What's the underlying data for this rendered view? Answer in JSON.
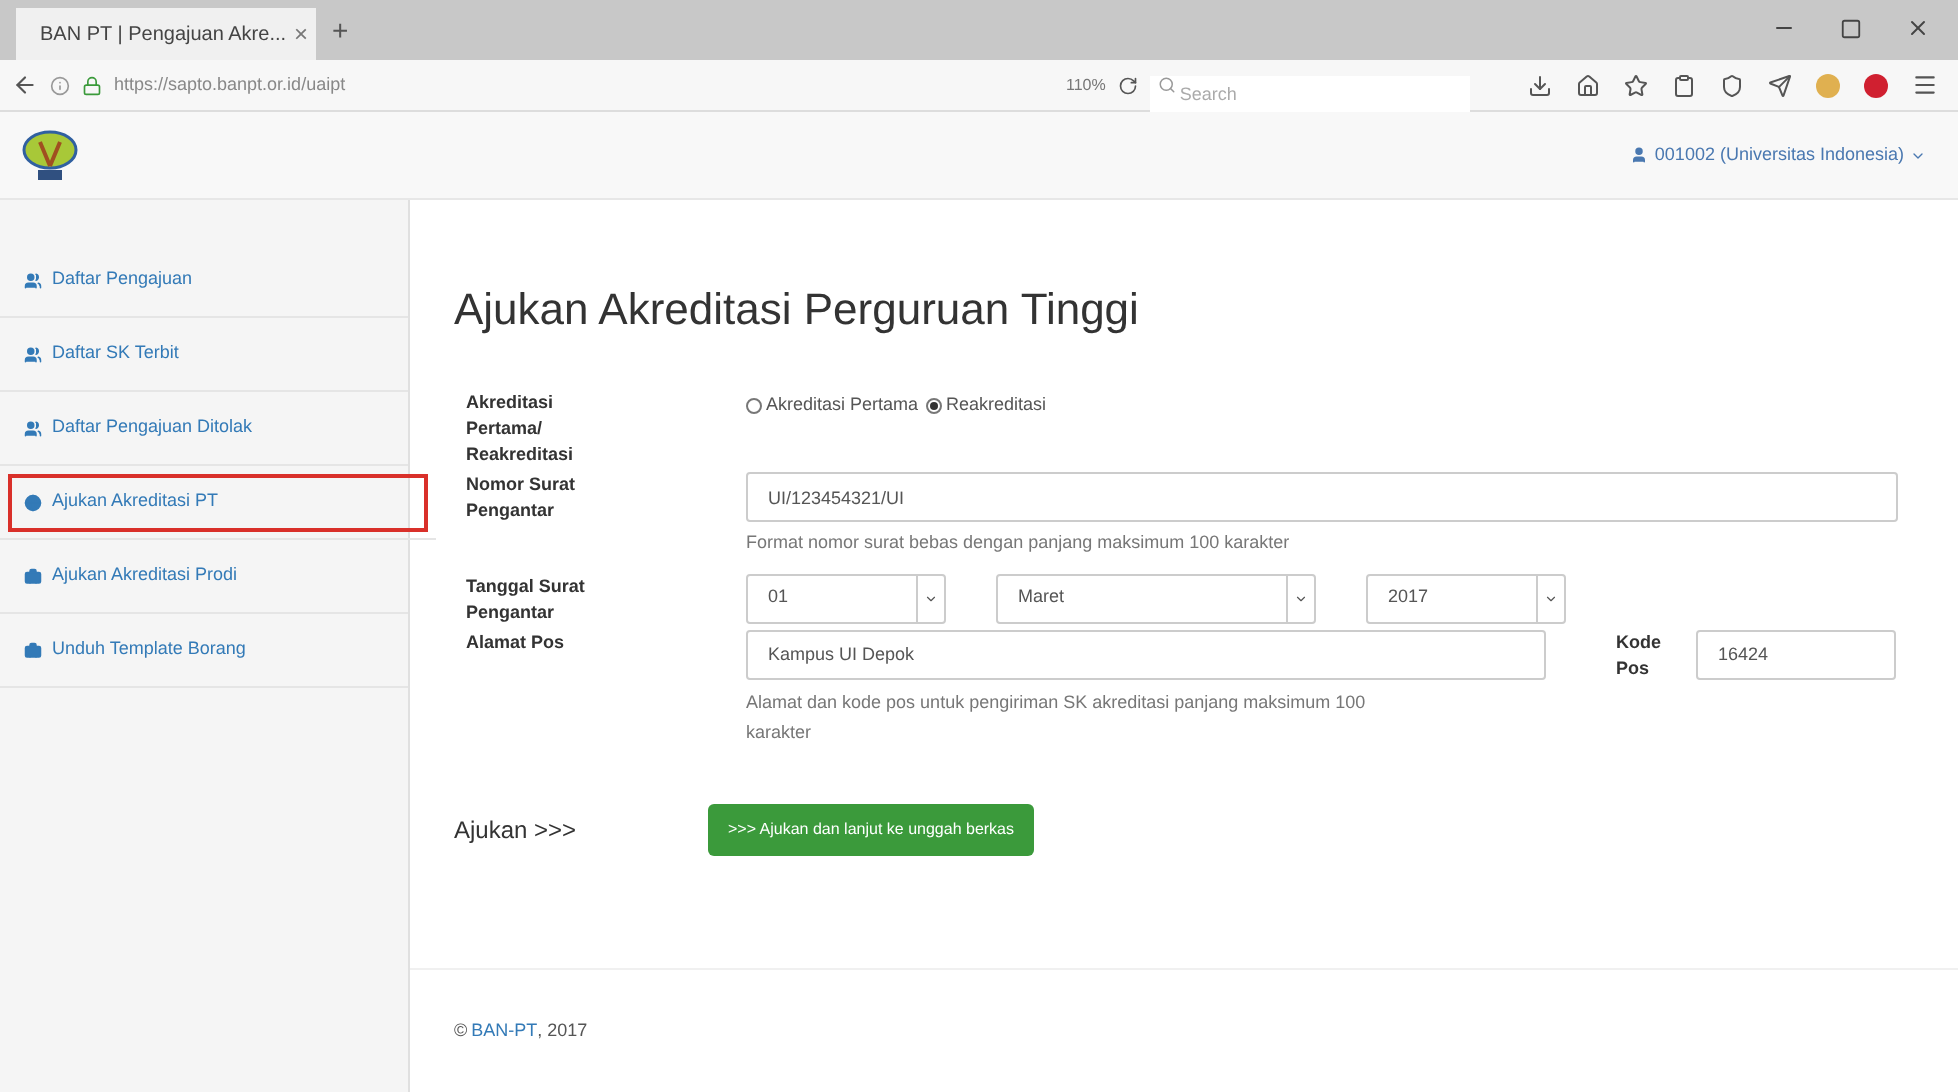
{
  "browser": {
    "tab_title": "BAN PT | Pengajuan Akre...",
    "tab_close": "×",
    "tab_new": "+",
    "url": "https://sapto.banpt.or.id/uaipt",
    "zoom": "110%",
    "search_placeholder": "Search"
  },
  "header": {
    "user": "001002 (Universitas Indonesia)"
  },
  "sidebar": {
    "items": [
      {
        "label": "Daftar Pengajuan",
        "annotated": false
      },
      {
        "label": "Daftar SK Terbit",
        "annotated": false
      },
      {
        "label": "Daftar Pengajuan Ditolak",
        "annotated": false
      },
      {
        "label": "Ajukan Akreditasi PT",
        "annotated": true
      },
      {
        "label": "Ajukan Akreditasi Prodi",
        "annotated": false
      },
      {
        "label": "Unduh Template Borang",
        "annotated": false
      }
    ]
  },
  "page_title": "Ajukan Akreditasi Perguruan Tinggi",
  "form": {
    "type_label": "Akreditasi Pertama/ Reakreditasi",
    "type_options": [
      {
        "label": "Akreditasi Pertama",
        "selected": false
      },
      {
        "label": "Reakreditasi",
        "selected": true
      }
    ],
    "number_label": "Nomor Surat Pengantar",
    "number_value": "UI/123454321/UI",
    "number_help": "Format nomor surat bebas dengan panjang maksimum 100 karakter",
    "date_label": "Tanggal Surat Pengantar",
    "date_selects": [
      {
        "value": "01"
      },
      {
        "value": "Maret"
      },
      {
        "value": "2017"
      }
    ],
    "address_label": "Alamat Pos",
    "address_value": "Kampus UI Depok",
    "postcode_label": "Kode Pos",
    "postcode_value": "16424",
    "address_help": "Alamat dan kode pos untuk pengiriman SK akreditasi panjang maksimum 100 karakter"
  },
  "submit": {
    "label": "Ajukan >>>",
    "button": ">>> Ajukan dan lanjut ke unggah berkas"
  },
  "footer": {
    "prefix": "©",
    "link": "BAN-PT",
    "suffix": ", 2017"
  }
}
